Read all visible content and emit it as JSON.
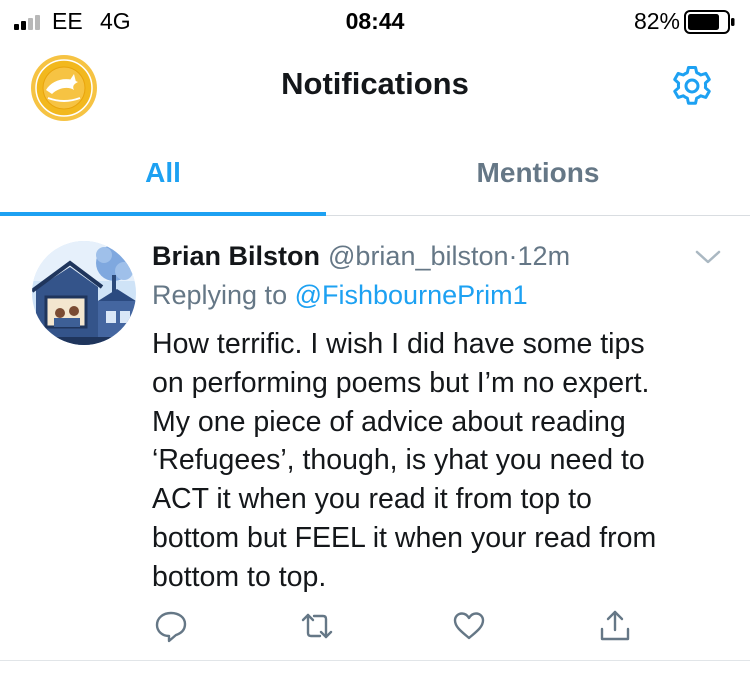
{
  "status_bar": {
    "carrier": "EE",
    "network": "4G",
    "time": "08:44",
    "battery_percent": "82%",
    "signal_bars": 2,
    "battery_level": 0.82
  },
  "header": {
    "title": "Notifications",
    "logo_icon": "school-logo-icon",
    "settings_icon": "gear-icon"
  },
  "tabs": [
    {
      "label": "All",
      "active": true
    },
    {
      "label": "Mentions",
      "active": false
    }
  ],
  "tweet": {
    "display_name": "Brian Bilston",
    "handle": "@brian_bilston",
    "separator": "·",
    "time": "12m",
    "replying_prefix": "Replying to",
    "replying_to": "@FishbournePrim1",
    "text_lines": [
      "How terrific. I wish I did have some tips",
      "on performing poems but I’m no expert.",
      "My one piece of advice about reading",
      "‘Refugees’, though, is yhat you need to",
      "ACT it when you read it from top to",
      "bottom but FEEL it when your read from",
      "bottom to top."
    ],
    "actions": [
      "reply-icon",
      "retweet-icon",
      "like-icon",
      "share-icon"
    ]
  },
  "colors": {
    "accent": "#1da1f2",
    "muted": "#657786",
    "text": "#14171a",
    "divider": "#e1e5e8"
  }
}
